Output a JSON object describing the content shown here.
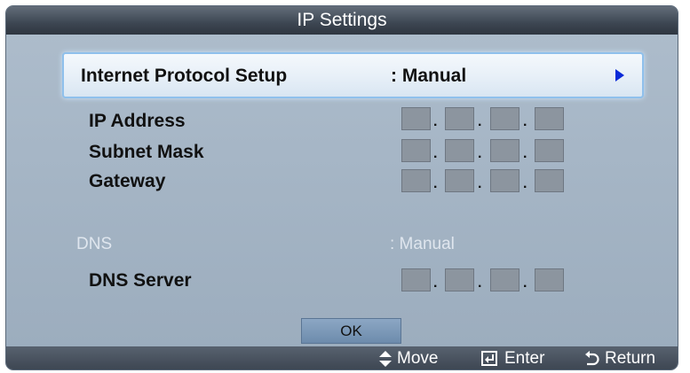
{
  "dialog": {
    "title": "IP Settings"
  },
  "setup": {
    "label": "Internet Protocol Setup",
    "value": ": Manual",
    "arrow_icon": "right-triangle-icon"
  },
  "fields": {
    "ip_address": "IP Address",
    "subnet_mask": "Subnet Mask",
    "gateway": "Gateway",
    "dot": "."
  },
  "dns": {
    "label": "DNS",
    "value": ": Manual",
    "server_label": "DNS Server"
  },
  "buttons": {
    "ok": "OK"
  },
  "hints": {
    "move": "Move",
    "enter": "Enter",
    "return": "Return",
    "move_icon": "up-down-arrows-icon",
    "enter_icon": "enter-icon",
    "return_icon": "return-arrow-icon"
  },
  "colors": {
    "panel": "#a6b6c6",
    "titlebar": "#3d4652",
    "highlight": "#e8f0f8",
    "arrow": "#0a2ad8"
  }
}
